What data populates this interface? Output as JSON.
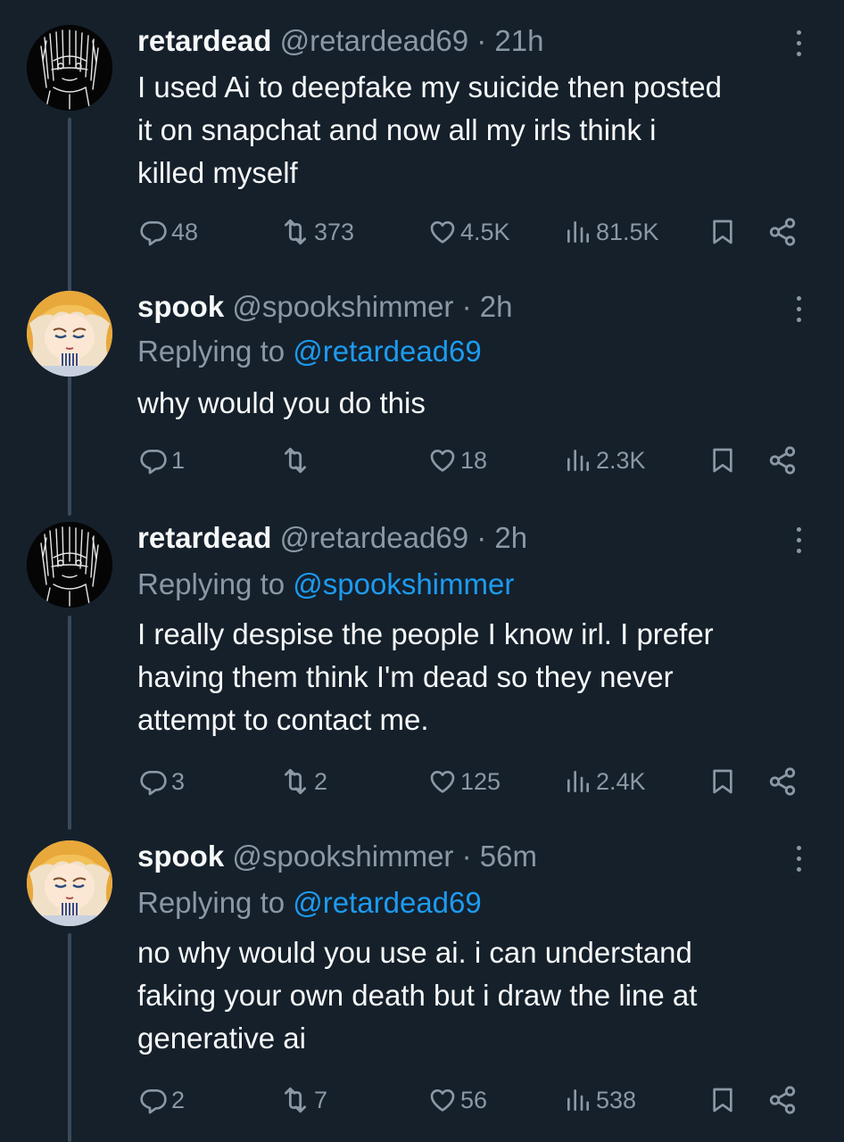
{
  "tweets": [
    {
      "name": "retardead",
      "handle": "@retardead69",
      "dot": "·",
      "time": "21h",
      "replying_prefix": "",
      "replying_to": "",
      "lines": [
        "I used Ai to deepfake my suicide then posted",
        "it on snapchat and now all my irls think i",
        "killed myself"
      ],
      "replies": "48",
      "reposts": "373",
      "likes": "4.5K",
      "views": "81.5K"
    },
    {
      "name": "spook",
      "handle": "@spookshimmer",
      "dot": "·",
      "time": "2h",
      "replying_prefix": "Replying to ",
      "replying_to": "@retardead69",
      "lines": [
        "why would you do this"
      ],
      "replies": "1",
      "reposts": "",
      "likes": "18",
      "views": "2.3K"
    },
    {
      "name": "retardead",
      "handle": "@retardead69",
      "dot": "·",
      "time": "2h",
      "replying_prefix": "Replying to ",
      "replying_to": "@spookshimmer",
      "lines": [
        "I really despise the people I know irl. I prefer",
        "having them think I'm dead so they never",
        "attempt to contact me."
      ],
      "replies": "3",
      "reposts": "2",
      "likes": "125",
      "views": "2.4K"
    },
    {
      "name": "spook",
      "handle": "@spookshimmer",
      "dot": "·",
      "time": "56m",
      "replying_prefix": "Replying to ",
      "replying_to": "@retardead69",
      "lines": [
        "no why would you use ai. i can understand",
        "faking your own death but i draw the line at",
        "generative ai"
      ],
      "replies": "2",
      "reposts": "7",
      "likes": "56",
      "views": "538"
    }
  ],
  "colors": {
    "background": "#15202b",
    "text": "#f7f9f9",
    "muted": "#8b98a5",
    "link": "#1d9bf0",
    "thread_line": "#3a4a5c"
  },
  "icons": {
    "reply": "reply-icon",
    "repost": "repost-icon",
    "like": "heart-icon",
    "views": "views-icon",
    "bookmark": "bookmark-icon",
    "share": "share-icon",
    "more": "more-icon"
  }
}
